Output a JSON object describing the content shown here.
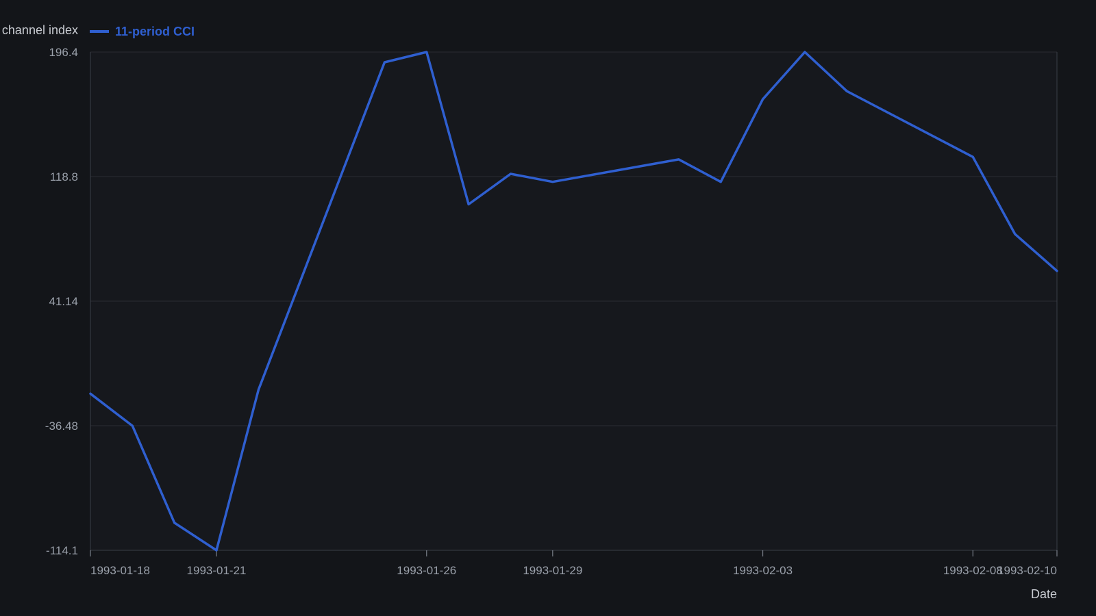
{
  "chart_data": {
    "type": "line",
    "title": "",
    "xlabel": "Date",
    "ylabel": "channel index",
    "x": [
      "1993-01-18",
      "1993-01-19",
      "1993-01-20",
      "1993-01-21",
      "1993-01-22",
      "1993-01-25",
      "1993-01-26",
      "1993-01-27",
      "1993-01-28",
      "1993-01-29",
      "1993-02-01",
      "1993-02-02",
      "1993-02-03",
      "1993-02-04",
      "1993-02-05",
      "1993-02-08",
      "1993-02-09",
      "1993-02-10"
    ],
    "series": [
      {
        "name": "11-period CCI",
        "color": "#2f5fd0",
        "values": [
          -16.5,
          -36.5,
          -97.0,
          -114.1,
          -14.0,
          190.0,
          196.4,
          101.5,
          120.5,
          115.5,
          129.5,
          115.5,
          167.0,
          196.4,
          172.0,
          131.0,
          83.0,
          60.0
        ]
      }
    ],
    "ylim": [
      -114.1,
      196.4
    ],
    "xlim": [
      "1993-01-18",
      "1993-02-10"
    ],
    "yticks": [
      "196.4",
      "118.8",
      "41.14",
      "-36.48",
      "-114.1"
    ],
    "ytick_values": [
      196.4,
      118.8,
      41.14,
      -36.48,
      -114.1
    ],
    "xticks": [
      "1993-01-18",
      "1993-01-21",
      "1993-01-26",
      "1993-01-29",
      "1993-02-03",
      "1993-02-08",
      "1993-02-10"
    ],
    "grid": true,
    "legend_position": "top-left",
    "colors": {
      "background": "#131519",
      "plot_background": "#16181d",
      "grid": "#2a2d33",
      "axis": "#3a3e46",
      "tick_text": "#9aa0aa",
      "title_text": "#c9ccd2"
    }
  }
}
